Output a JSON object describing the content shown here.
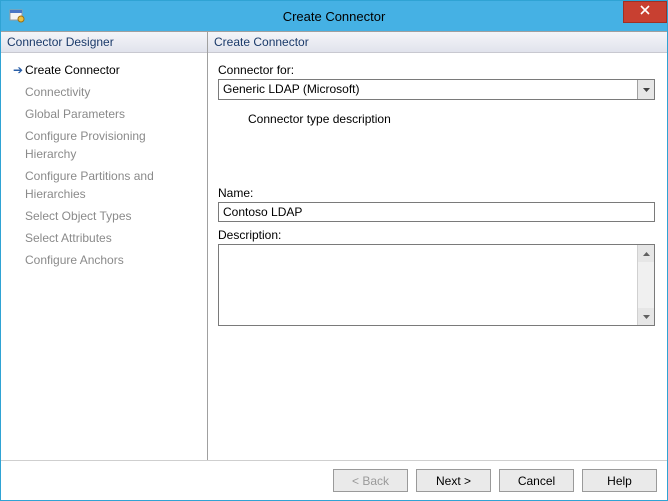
{
  "window": {
    "title": "Create Connector"
  },
  "left": {
    "header": "Connector Designer",
    "items": [
      {
        "label": "Create Connector",
        "active": true
      },
      {
        "label": "Connectivity",
        "active": false
      },
      {
        "label": "Global Parameters",
        "active": false
      },
      {
        "label": "Configure Provisioning Hierarchy",
        "active": false
      },
      {
        "label": "Configure Partitions and Hierarchies",
        "active": false
      },
      {
        "label": "Select Object Types",
        "active": false
      },
      {
        "label": "Select Attributes",
        "active": false
      },
      {
        "label": "Configure Anchors",
        "active": false
      }
    ]
  },
  "right": {
    "header": "Create Connector",
    "connector_for_label": "Connector for:",
    "connector_for_value": "Generic LDAP (Microsoft)",
    "type_description": "Connector type description",
    "name_label": "Name:",
    "name_value": "Contoso LDAP",
    "description_label": "Description:",
    "description_value": ""
  },
  "buttons": {
    "back": "<  Back",
    "next": "Next  >",
    "cancel": "Cancel",
    "help": "Help"
  }
}
